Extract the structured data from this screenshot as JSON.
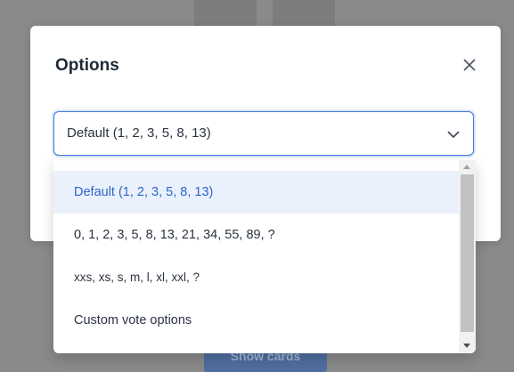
{
  "modal": {
    "title": "Options",
    "close_icon": "close-icon"
  },
  "select": {
    "value": "Default (1, 2, 3, 5, 8, 13)",
    "chevron_icon": "chevron-down-icon"
  },
  "dropdown": {
    "options": [
      "Default (1, 2, 3, 5, 8, 13)",
      "0, 1, 2, 3, 5, 8, 13, 21, 34, 55, 89, ?",
      "xxs, xs, s, m, l, xl, xxl, ?",
      "Custom vote options"
    ],
    "selected_index": 0
  },
  "background": {
    "button_label": "Show cards"
  },
  "colors": {
    "accent": "#3b78d8",
    "selected_bg": "#eaf1fc",
    "overlay": "#8a8a8a"
  }
}
